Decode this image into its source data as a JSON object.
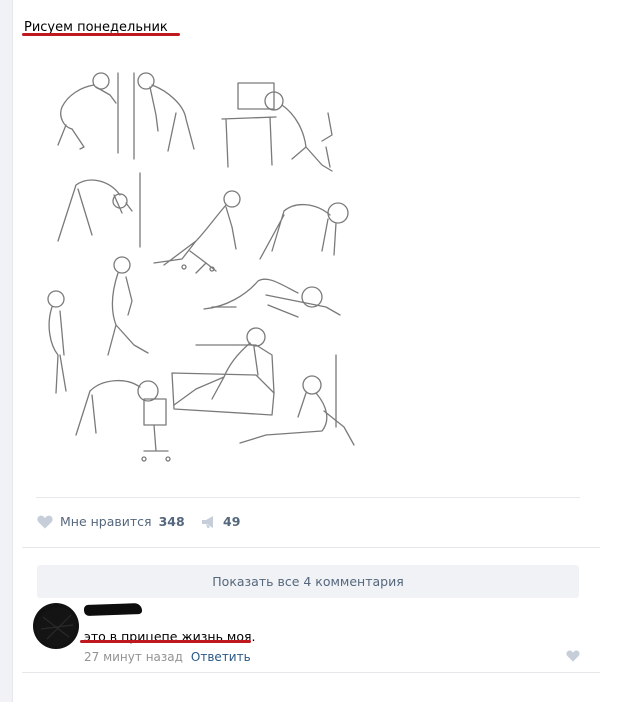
{
  "post": {
    "title": "Рисуем понедельник",
    "illustration_icon": "figure-sketches-illustration"
  },
  "actions": {
    "like_label": "Мне нравится",
    "like_count": "348",
    "share_count": "49",
    "like_icon": "heart-icon",
    "share_icon": "megaphone-icon"
  },
  "comments": {
    "show_all_label": "Показать все 4 комментария",
    "items": [
      {
        "text": "это в прицепе жизнь моя.",
        "timestamp": "27 минут назад",
        "reply_label": "Ответить"
      }
    ]
  },
  "colors": {
    "annotation_red": "#c0181f",
    "muted_blue_gray": "#55677d",
    "link_blue": "#2a5885",
    "icon_gray": "#c5ced9"
  }
}
